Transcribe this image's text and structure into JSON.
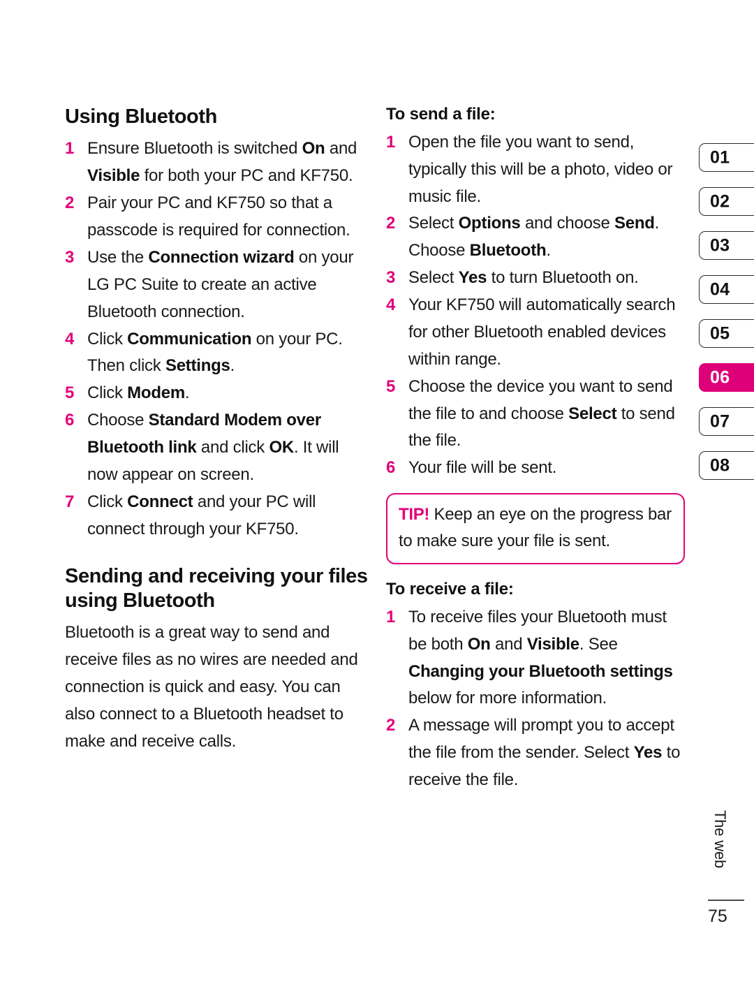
{
  "document": {
    "page_number": "75",
    "chapter_label": "The web",
    "accent_color": "#E2007A",
    "active_tab_color": "#DD0079"
  },
  "left_column": {
    "heading": "Using Bluetooth",
    "steps": [
      {
        "num": "1",
        "parts": [
          {
            "t": "Ensure Bluetooth is switched ",
            "b": false
          },
          {
            "t": "On",
            "b": true
          },
          {
            "t": " and ",
            "b": false
          },
          {
            "t": "Visible",
            "b": true
          },
          {
            "t": " for both your PC and KF750.",
            "b": false
          }
        ]
      },
      {
        "num": "2",
        "parts": [
          {
            "t": "Pair your PC and KF750 so that a passcode is required for connection.",
            "b": false
          }
        ]
      },
      {
        "num": "3",
        "parts": [
          {
            "t": "Use the ",
            "b": false
          },
          {
            "t": "Connection wizard",
            "b": true
          },
          {
            "t": " on your LG PC Suite to create an active Bluetooth connection.",
            "b": false
          }
        ]
      },
      {
        "num": "4",
        "parts": [
          {
            "t": "Click ",
            "b": false
          },
          {
            "t": "Communication",
            "b": true
          },
          {
            "t": " on your PC. Then click ",
            "b": false
          },
          {
            "t": "Settings",
            "b": true
          },
          {
            "t": ".",
            "b": false
          }
        ]
      },
      {
        "num": "5",
        "parts": [
          {
            "t": "Click ",
            "b": false
          },
          {
            "t": "Modem",
            "b": true
          },
          {
            "t": ".",
            "b": false
          }
        ]
      },
      {
        "num": "6",
        "parts": [
          {
            "t": "Choose ",
            "b": false
          },
          {
            "t": "Standard Modem over Bluetooth link",
            "b": true
          },
          {
            "t": " and click ",
            "b": false
          },
          {
            "t": "OK",
            "b": true
          },
          {
            "t": ". It will now appear on screen.",
            "b": false
          }
        ]
      },
      {
        "num": "7",
        "parts": [
          {
            "t": "Click ",
            "b": false
          },
          {
            "t": "Connect",
            "b": true
          },
          {
            "t": " and your PC will connect through your KF750.",
            "b": false
          }
        ]
      }
    ],
    "heading2": "Sending and receiving your files using Bluetooth",
    "paragraph": "Bluetooth is a great way to send and receive files as no wires are needed and connection is quick and easy. You can also connect to a Bluetooth headset to make and receive calls."
  },
  "right_column": {
    "send_heading": "To send a file:",
    "send_steps": [
      {
        "num": "1",
        "parts": [
          {
            "t": "Open the file you want to send, typically this will be a photo, video or music file.",
            "b": false
          }
        ]
      },
      {
        "num": "2",
        "parts": [
          {
            "t": "Select ",
            "b": false
          },
          {
            "t": "Options",
            "b": true
          },
          {
            "t": " and choose ",
            "b": false
          },
          {
            "t": "Send",
            "b": true
          },
          {
            "t": ". Choose ",
            "b": false
          },
          {
            "t": "Bluetooth",
            "b": true
          },
          {
            "t": ".",
            "b": false
          }
        ]
      },
      {
        "num": "3",
        "parts": [
          {
            "t": "Select ",
            "b": false
          },
          {
            "t": "Yes",
            "b": true
          },
          {
            "t": " to turn Bluetooth on.",
            "b": false
          }
        ]
      },
      {
        "num": "4",
        "parts": [
          {
            "t": "Your KF750 will automatically search for other Bluetooth enabled devices within range.",
            "b": false
          }
        ]
      },
      {
        "num": "5",
        "parts": [
          {
            "t": "Choose the device you want to send the file to and choose ",
            "b": false
          },
          {
            "t": "Select",
            "b": true
          },
          {
            "t": " to send the file.",
            "b": false
          }
        ]
      },
      {
        "num": "6",
        "parts": [
          {
            "t": "Your file will be sent.",
            "b": false
          }
        ]
      }
    ],
    "tip": {
      "label": "TIP!",
      "text": " Keep an eye on the progress bar to make sure your file is sent."
    },
    "receive_heading": "To receive a file:",
    "receive_steps": [
      {
        "num": "1",
        "parts": [
          {
            "t": "To receive files your Bluetooth must be both ",
            "b": false
          },
          {
            "t": "On",
            "b": true
          },
          {
            "t": " and ",
            "b": false
          },
          {
            "t": "Visible",
            "b": true
          },
          {
            "t": ". See ",
            "b": false
          },
          {
            "t": "Changing your Bluetooth settings",
            "b": true
          },
          {
            "t": " below for more information.",
            "b": false
          }
        ]
      },
      {
        "num": "2",
        "parts": [
          {
            "t": "A message will prompt you to accept the file from the sender. Select ",
            "b": false
          },
          {
            "t": "Yes",
            "b": true
          },
          {
            "t": " to receive the file.",
            "b": false
          }
        ]
      }
    ]
  },
  "tab_rail": {
    "tabs": [
      {
        "label": "01",
        "active": false
      },
      {
        "label": "02",
        "active": false
      },
      {
        "label": "03",
        "active": false
      },
      {
        "label": "04",
        "active": false
      },
      {
        "label": "05",
        "active": false
      },
      {
        "label": "06",
        "active": true
      },
      {
        "label": "07",
        "active": false
      },
      {
        "label": "08",
        "active": false
      }
    ]
  }
}
